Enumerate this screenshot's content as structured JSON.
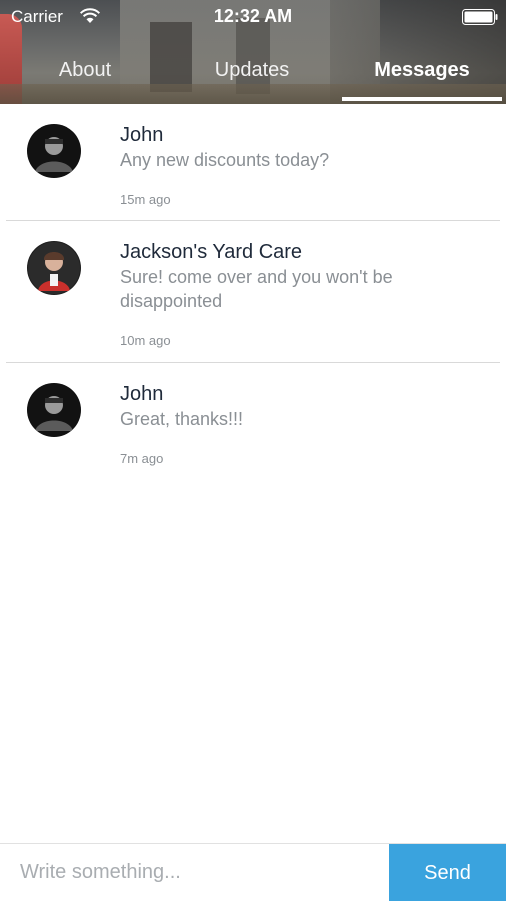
{
  "status_bar": {
    "carrier": "Carrier",
    "time": "12:32 AM"
  },
  "tabs": [
    {
      "label": "About",
      "active": false
    },
    {
      "label": "Updates",
      "active": false
    },
    {
      "label": "Messages",
      "active": true
    }
  ],
  "messages": [
    {
      "sender": "John",
      "text": "Any new discounts today?",
      "time": "15m ago"
    },
    {
      "sender": "Jackson's Yard Care",
      "text": "Sure! come over and you won't be disappointed",
      "time": "10m ago"
    },
    {
      "sender": "John",
      "text": "Great, thanks!!!",
      "time": "7m ago"
    }
  ],
  "composer": {
    "placeholder": "Write something...",
    "send_label": "Send"
  },
  "colors": {
    "accent": "#3aa3de",
    "sender": "#1f2a3a",
    "muted": "#8a8f94",
    "divider": "#d9d9d9"
  },
  "icons": {
    "wifi": "wifi-icon",
    "battery": "battery-icon"
  }
}
